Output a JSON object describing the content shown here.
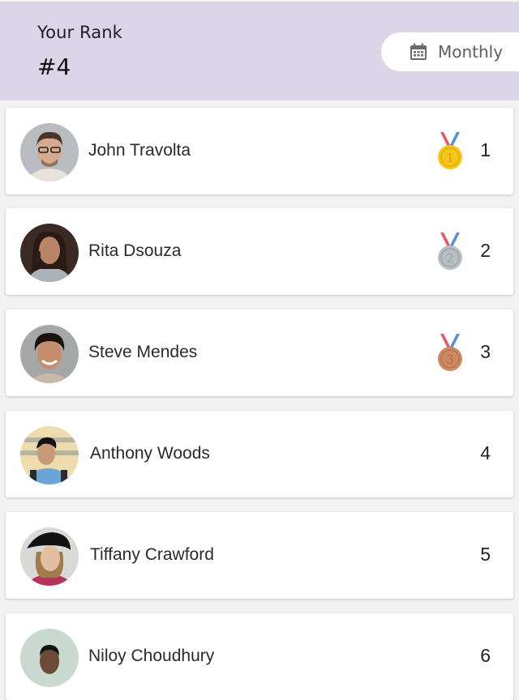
{
  "header": {
    "rank_label": "Your Rank",
    "rank_value": "#4",
    "period": {
      "label": "Monthly",
      "icon": "calendar-icon"
    }
  },
  "colors": {
    "header_bg": "#dcd5e8",
    "gold": "#f5c518",
    "silver": "#b8c0c4",
    "bronze": "#cd8a63"
  },
  "leaderboard": [
    {
      "name": "John Travolta",
      "rank": "1",
      "medal": "gold-medal-icon"
    },
    {
      "name": "Rita Dsouza",
      "rank": "2",
      "medal": "silver-medal-icon"
    },
    {
      "name": "Steve Mendes",
      "rank": "3",
      "medal": "bronze-medal-icon"
    },
    {
      "name": "Anthony Woods",
      "rank": "4",
      "medal": null
    },
    {
      "name": "Tiffany Crawford",
      "rank": "5",
      "medal": null
    },
    {
      "name": "Niloy Choudhury",
      "rank": "6",
      "medal": null
    }
  ]
}
